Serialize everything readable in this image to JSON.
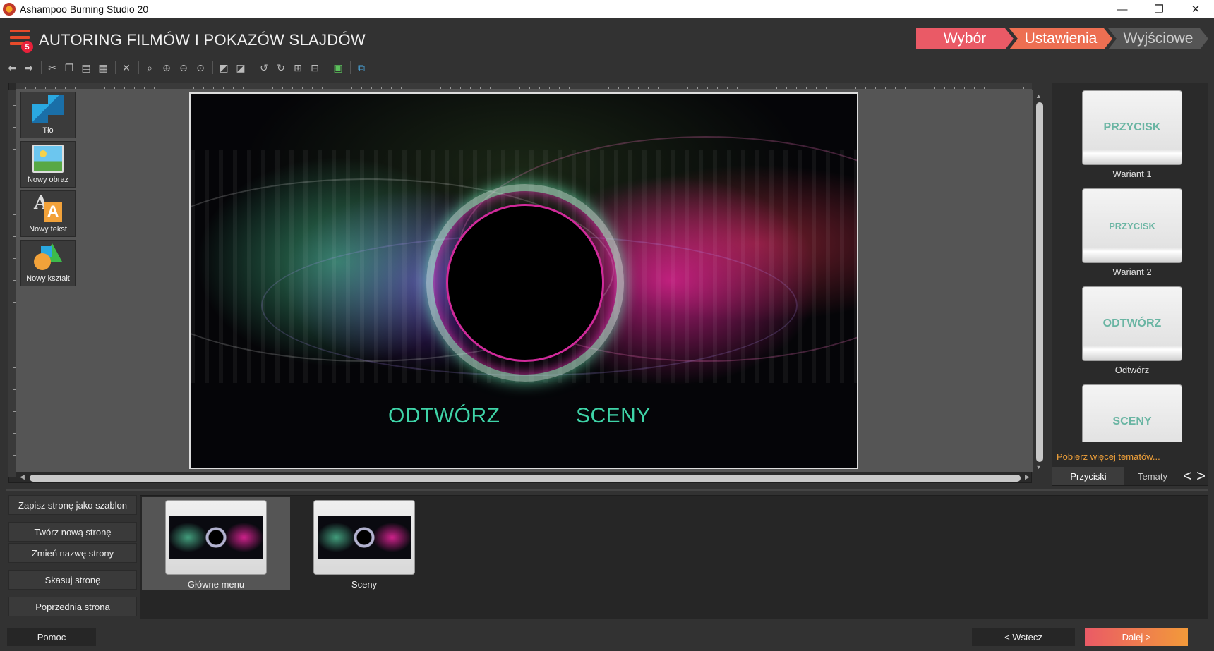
{
  "window": {
    "title": "Ashampoo Burning Studio 20",
    "controls": {
      "minimize": "—",
      "restore": "❐",
      "close": "✕"
    }
  },
  "header": {
    "badge": "5",
    "title": "AUTORING FILMÓW I POKAZÓW SLAJDÓW",
    "steps": [
      {
        "label": "Wybór"
      },
      {
        "label": "Ustawienia"
      },
      {
        "label": "Wyjściowe"
      }
    ]
  },
  "toolbar": {
    "icons": [
      "back-arrow-icon",
      "forward-arrow-icon",
      "cut-icon",
      "copy-icon",
      "paste-icon",
      "paste-special-icon",
      "delete-icon",
      "zoom-fit-icon",
      "zoom-in-icon",
      "zoom-out-icon",
      "zoom-actual-icon",
      "bring-front-icon",
      "send-back-icon",
      "rotate-left-icon",
      "rotate-right-icon",
      "align-icon",
      "distribute-icon",
      "image-icon",
      "layers-icon"
    ]
  },
  "tools": [
    {
      "label": "Tło",
      "icon": "background-icon"
    },
    {
      "label": "Nowy obraz",
      "icon": "image-icon"
    },
    {
      "label": "Nowy tekst",
      "icon": "text-icon"
    },
    {
      "label": "Nowy kształt",
      "icon": "shape-icon"
    }
  ],
  "preview": {
    "play_label": "ODTWÓRZ",
    "scenes_label": "SCENY"
  },
  "right_panel": {
    "variants": [
      {
        "card_text": "PRZYCISK",
        "label": "Wariant 1"
      },
      {
        "card_text": "PRZYCISK",
        "label": "Wariant 2"
      },
      {
        "card_text": "ODTWÓRZ",
        "label": "Odtwórz"
      },
      {
        "card_text": "SCENY",
        "label": ""
      }
    ],
    "more_link": "Pobierz więcej tematów...",
    "tabs": {
      "buttons": "Przyciski",
      "themes": "Tematy"
    },
    "nav": {
      "prev": "<",
      "next": ">"
    }
  },
  "page_actions": {
    "save_template": "Zapisz stronę jako szablon",
    "new_page": "Twórz nową stronę",
    "rename_page": "Zmień nazwę strony",
    "delete_page": "Skasuj stronę",
    "previous_page": "Poprzednia strona"
  },
  "pages": [
    {
      "label": "Główne menu",
      "selected": true
    },
    {
      "label": "Sceny",
      "selected": false
    }
  ],
  "footer": {
    "help": "Pomoc",
    "back": "< Wstecz",
    "next": "Dalej >"
  },
  "colors": {
    "accent_red": "#ea5a66",
    "accent_orange": "#ed6f52",
    "link_orange": "#f2a23a",
    "preview_text": "#3fd4a8"
  }
}
